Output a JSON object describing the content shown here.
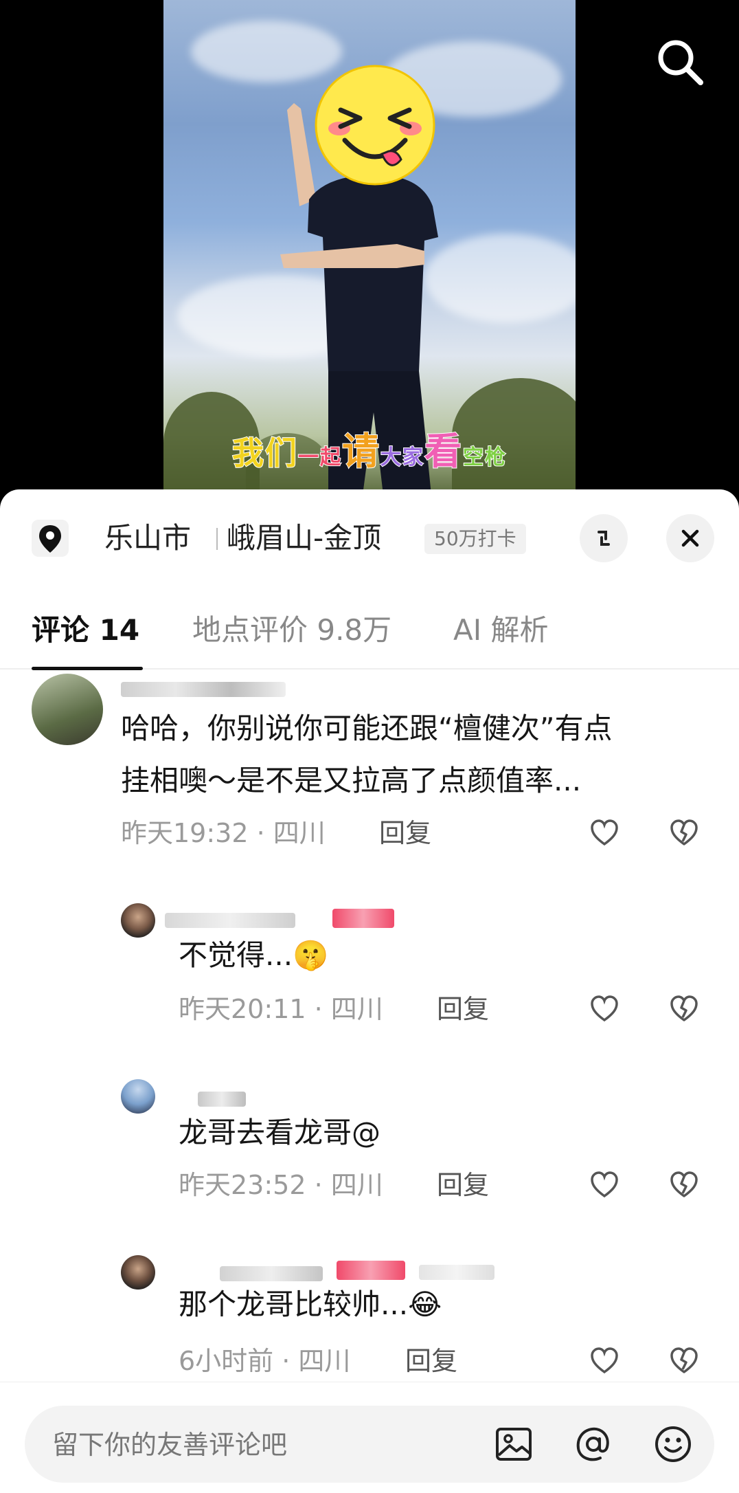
{
  "video": {
    "caption_parts": [
      {
        "text": "我们",
        "color": "#f2d31f"
      },
      {
        "text": "一起",
        "color": "#f04a6a"
      },
      {
        "text": "请",
        "color": "#f2a11f"
      },
      {
        "text": "大家",
        "color": "#9a6ce0"
      },
      {
        "text": "看",
        "color": "#f05fb4"
      },
      {
        "text": "空枪",
        "color": "#7fd044"
      }
    ],
    "search_icon": "search-icon"
  },
  "location": {
    "icon": "location-pin-icon",
    "city": "乐山市",
    "place": "峨眉山-金顶",
    "badge": "50万打卡",
    "expand_icon": "collapse-icon",
    "close_icon": "close-icon"
  },
  "tabs": [
    {
      "label": "评论 14",
      "active": true
    },
    {
      "label": "地点评价 9.8万",
      "active": false
    },
    {
      "label": "AI 解析",
      "active": false
    }
  ],
  "comments": [
    {
      "text_line1": "哈哈，你别说你可能还跟“檀健次”有点",
      "text_line2": "挂相噢～是不是又拉高了点颜值率...",
      "meta": "昨天19:32 · 四川",
      "reply": "回复"
    },
    {
      "text": "不觉得...",
      "emoji": "🤫",
      "meta": "昨天20:11 · 四川",
      "reply": "回复"
    },
    {
      "text": "龙哥去看龙哥@",
      "meta": "昨天23:52 · 四川",
      "reply": "回复"
    },
    {
      "text": "那个龙哥比较帅...",
      "emoji": "😂",
      "meta": "6小时前 · 四川",
      "reply": "回复"
    }
  ],
  "input": {
    "placeholder": "留下你的友善评论吧",
    "icons": [
      "image-icon",
      "at-icon",
      "emoji-icon"
    ]
  },
  "colors": {
    "panel_bg": "#ffffff",
    "meta_text": "#9a9a9a",
    "tab_active": "#111111",
    "tab_inactive": "#888888"
  }
}
